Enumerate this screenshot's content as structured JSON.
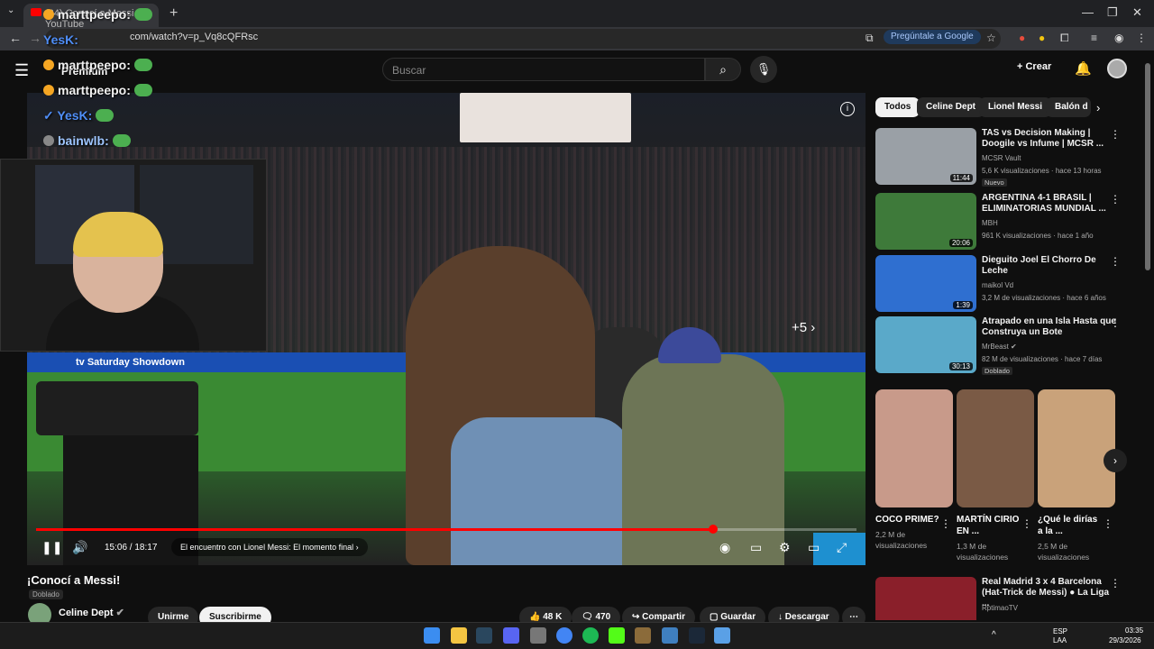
{
  "browser": {
    "tab_title": "(34) Conocí a Messi - YouTube",
    "url": "com/watch?v=p_Vq8cQFRsc",
    "ask_google": "Pregúntale a Google"
  },
  "header": {
    "search_placeholder": "Buscar",
    "create_label": "Crear",
    "logo_text": "Premium"
  },
  "chat": [
    {
      "user": "marttpeepo:",
      "color": "#ffffff"
    },
    {
      "user": "YesK:",
      "color": "#4f8ef7"
    },
    {
      "user": "marttpeepo:",
      "color": "#ffffff"
    },
    {
      "user": "marttpeepo:",
      "color": "#ffffff"
    },
    {
      "user": "YesK:",
      "color": "#4f8ef7"
    },
    {
      "user": "bainwlb:",
      "color": "#9ec5ff"
    }
  ],
  "player": {
    "time": "15:06 / 18:17",
    "chapter": "El encuentro con Lionel Messi: El momento final",
    "more_count": "+5",
    "ad_text": "tv  Saturday Showdown",
    "progress_fraction": 0.825,
    "colors": {
      "progress": "#ff0000"
    }
  },
  "video": {
    "title": "¡Conocí a Messi!",
    "dubbed": "Doblado",
    "channel": "Celine Dept",
    "join_label": "Unirme",
    "subscribe_label": "Suscribirme",
    "likes": "48 K",
    "comments": "470",
    "share_label": "Compartir",
    "save_label": "Guardar",
    "download_label": "Descargar"
  },
  "chips": [
    "Todos",
    "Celine Dept",
    "Lionel Messi",
    "Balón d"
  ],
  "recommendations": [
    {
      "title": "TAS vs Decision Making | Doogile vs Infume | MCSR ...",
      "channel": "MCSR Vault",
      "meta": "5,6 K visualizaciones · hace 13 horas",
      "badge": "Nuevo",
      "duration": "11:44",
      "thumb": "#9aa0a6"
    },
    {
      "title": "ARGENTINA 4-1 BRASIL | ELIMINATORIAS MUNDIAL ...",
      "channel": "MBH",
      "meta": "961 K visualizaciones · hace 1 año",
      "badge": "",
      "duration": "20:06",
      "thumb": "#3e7a3a"
    },
    {
      "title": "Dieguito Joel El Chorro De Leche",
      "channel": "maikol Vd",
      "meta": "3,2 M de visualizaciones · hace 6 años",
      "badge": "",
      "duration": "1:39",
      "thumb": "#2f6fd0"
    },
    {
      "title": "Atrapado en una Isla Hasta que Construya un Bote",
      "channel": "MrBeast",
      "meta": "82 M de visualizaciones · hace 7 días",
      "badge": "Doblado",
      "duration": "30:13",
      "thumb": "#5aa9c9"
    },
    {
      "title": "Real Madrid 3 x 4 Barcelona (Hat-Trick de Messi) ● La Liga ...",
      "channel": "RptimaoTV",
      "meta": "",
      "badge": "",
      "duration": "",
      "thumb": "#8a1f2a"
    }
  ],
  "shorts": [
    {
      "title": "COCO PRIME?",
      "views_line1": "2,2 M de",
      "views_line2": "visualizaciones",
      "thumb": "#c89a8a"
    },
    {
      "title": "MARTÍN CIRIO EN ...",
      "views_line1": "1,3 M de",
      "views_line2": "visualizaciones",
      "thumb": "#7a5a45"
    },
    {
      "title": "¿Qué le dirías a la ...",
      "views_line1": "2,5 M de",
      "views_line2": "visualizaciones",
      "thumb": "#c9a27a"
    }
  ],
  "taskbar": {
    "lang1": "ESP",
    "lang2": "LAA",
    "time": "03:35",
    "date": "29/3/2026"
  }
}
